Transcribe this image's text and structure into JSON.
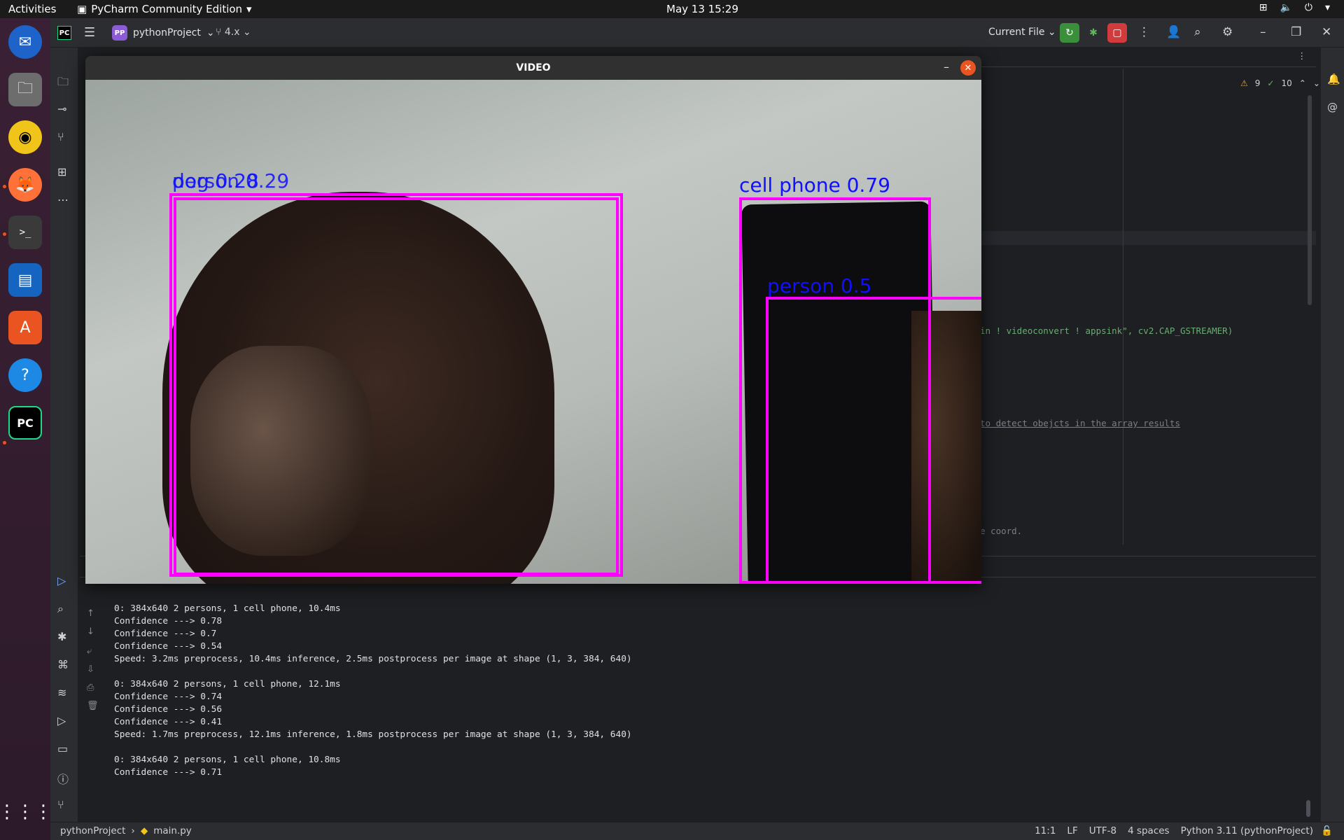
{
  "topbar": {
    "activities": "Activities",
    "app_name": "PyCharm Community Edition",
    "clock": "May 13  15:29"
  },
  "ide": {
    "logo": "PC",
    "project_badge": "PP",
    "project_name": "pythonProject",
    "branch": "4.x",
    "run_config": "Current File",
    "warnings": "9",
    "checks": "10"
  },
  "editor": {
    "code_line_1": "in ! videoconvert ! appsink\", cv2.CAP_GSTREAMER)",
    "code_line_2": "to detect obejcts in the array results",
    "code_line_3": "e coord."
  },
  "video_window": {
    "title": "VIDEO",
    "detections": [
      {
        "label": "dog 0.28"
      },
      {
        "label": "person 0.29"
      },
      {
        "label": "cell phone 0.79"
      },
      {
        "label": "person 0.5"
      }
    ]
  },
  "console": {
    "lines": [
      "0: 384x640 2 persons, 1 cell phone, 10.4ms",
      "Confidence ---> 0.78",
      "Confidence ---> 0.7",
      "Confidence ---> 0.54",
      "Speed: 3.2ms preprocess, 10.4ms inference, 2.5ms postprocess per image at shape (1, 3, 384, 640)",
      "",
      "0: 384x640 2 persons, 1 cell phone, 12.1ms",
      "Confidence ---> 0.74",
      "Confidence ---> 0.56",
      "Confidence ---> 0.41",
      "Speed: 1.7ms preprocess, 12.1ms inference, 1.8ms postprocess per image at shape (1, 3, 384, 640)",
      "",
      "0: 384x640 2 persons, 1 cell phone, 10.8ms",
      "Confidence ---> 0.71"
    ]
  },
  "status": {
    "project": "pythonProject",
    "file": "main.py",
    "position": "11:1",
    "line_sep": "LF",
    "encoding": "UTF-8",
    "indent": "4 spaces",
    "interpreter": "Python 3.11 (pythonProject)"
  },
  "colors": {
    "bbox": "#ff00ff",
    "bbox_label": "#1010ff",
    "accent": "#e95420"
  }
}
